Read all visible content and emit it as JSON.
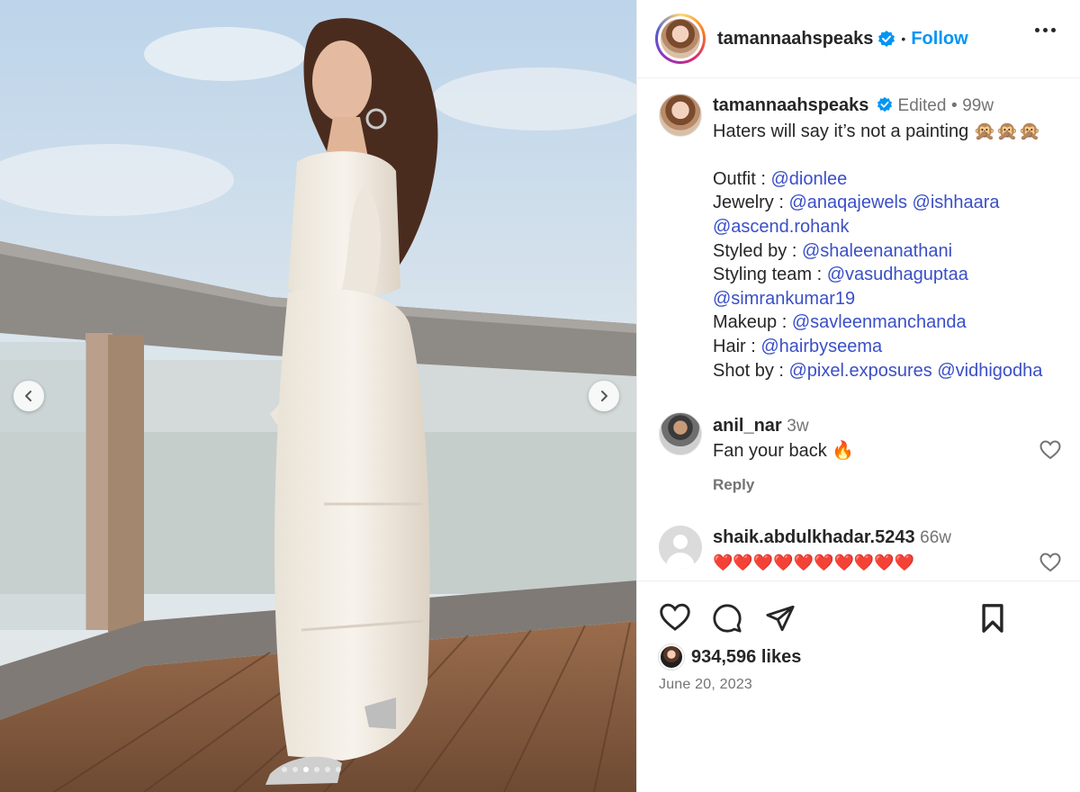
{
  "post": {
    "username": "tamannaahspeaks",
    "follow_label": "Follow",
    "separator": "•",
    "caption": {
      "edited_label": "Edited",
      "age": "99w",
      "first_line": "Haters will say it’s not a painting 🙊🙊🙊",
      "outfit_label": "Outfit :",
      "outfit_tag": "@dionlee",
      "jewelry_label": "Jewelry :",
      "jewelry_tags": [
        "@anaqajewels",
        "@ishhaara",
        "@ascend.rohank"
      ],
      "styled_label": "Styled by :",
      "styled_tag": "@shaleenanathani",
      "team_label": "Styling team :",
      "team_tags": [
        "@vasudhaguptaa",
        "@simrankumar19"
      ],
      "makeup_label": "Makeup :",
      "makeup_tag": "@savleenmanchanda",
      "hair_label": "Hair :",
      "hair_tag": "@hairbyseema",
      "shot_label": "Shot by :",
      "shot_tags": [
        "@pixel.exposures",
        "@vidhigodha"
      ]
    },
    "comments": [
      {
        "username": "anil_nar",
        "age": "3w",
        "text": "Fan your back 🔥",
        "reply_label": "Reply"
      },
      {
        "username": "shaik.abdulkhadar.5243",
        "age": "66w",
        "text": "❤️❤️❤️❤️❤️❤️❤️❤️❤️❤️"
      }
    ],
    "likes": "934,596 likes",
    "date": "June 20, 2023"
  },
  "carousel": {
    "slides": 6,
    "active_index": 2
  },
  "colors": {
    "link": "#3a4fc7",
    "follow": "#0095f6",
    "verified": "#0095f6",
    "muted": "#737373"
  },
  "icons": [
    "verified-badge-icon",
    "more-options-icon",
    "heart-icon",
    "comment-icon",
    "share-icon",
    "bookmark-icon",
    "chevron-left-icon",
    "chevron-right-icon"
  ]
}
